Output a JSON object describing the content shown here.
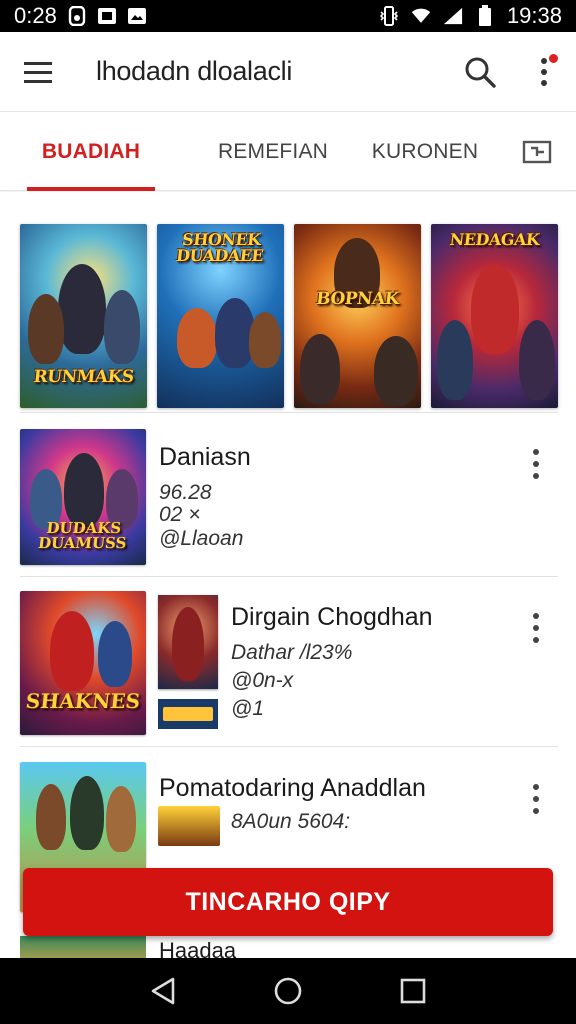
{
  "status_bar": {
    "time_left": "0:28",
    "time_right": "19:38",
    "icons": [
      "status-app-icon",
      "status-image-icon",
      "status-image-icon",
      "vibrate-icon",
      "wifi-icon",
      "signal-icon",
      "battery-icon"
    ]
  },
  "app_bar": {
    "title": "lhodadn dloalacli",
    "icons": [
      "hamburger-menu-icon",
      "search-icon",
      "more-vertical-icon"
    ],
    "has_notification": true
  },
  "tabs": [
    {
      "label": "BUADIAH",
      "active": true
    },
    {
      "label": "REMEFIAN",
      "active": false
    },
    {
      "label": "KURONEN",
      "active": false
    }
  ],
  "tab_overflow_icon": "tab-overflow-icon",
  "featured": [
    {
      "title": "RUNMAKS"
    },
    {
      "title": "SHONEK DUADAEE"
    },
    {
      "title": "BOPNAK"
    },
    {
      "title": "NEDAGAK"
    }
  ],
  "list": [
    {
      "title": "Daniasn",
      "meta": [
        "96.28",
        "02  ×",
        "@Llaoan"
      ],
      "thumb_title": "DUDAKS DUAMUSS"
    },
    {
      "title": "Dirgain Chogdhan",
      "meta": [
        "Dathar /l23%",
        "@0n-x",
        "@1"
      ],
      "thumb_title": "SHAKNES"
    },
    {
      "title": "Pomatodaring Anaddlan",
      "meta": [
        "8A0un 5604:"
      ],
      "thumb_title": ""
    }
  ],
  "next_row_partial_title": "Haadaa",
  "cta": {
    "label": "TINCARHO QIPY"
  },
  "nav_bar": {
    "icons": [
      "back-icon",
      "home-icon",
      "recents-icon"
    ]
  },
  "colors": {
    "accent": "#d21f1f",
    "cta": "#d2130f"
  }
}
